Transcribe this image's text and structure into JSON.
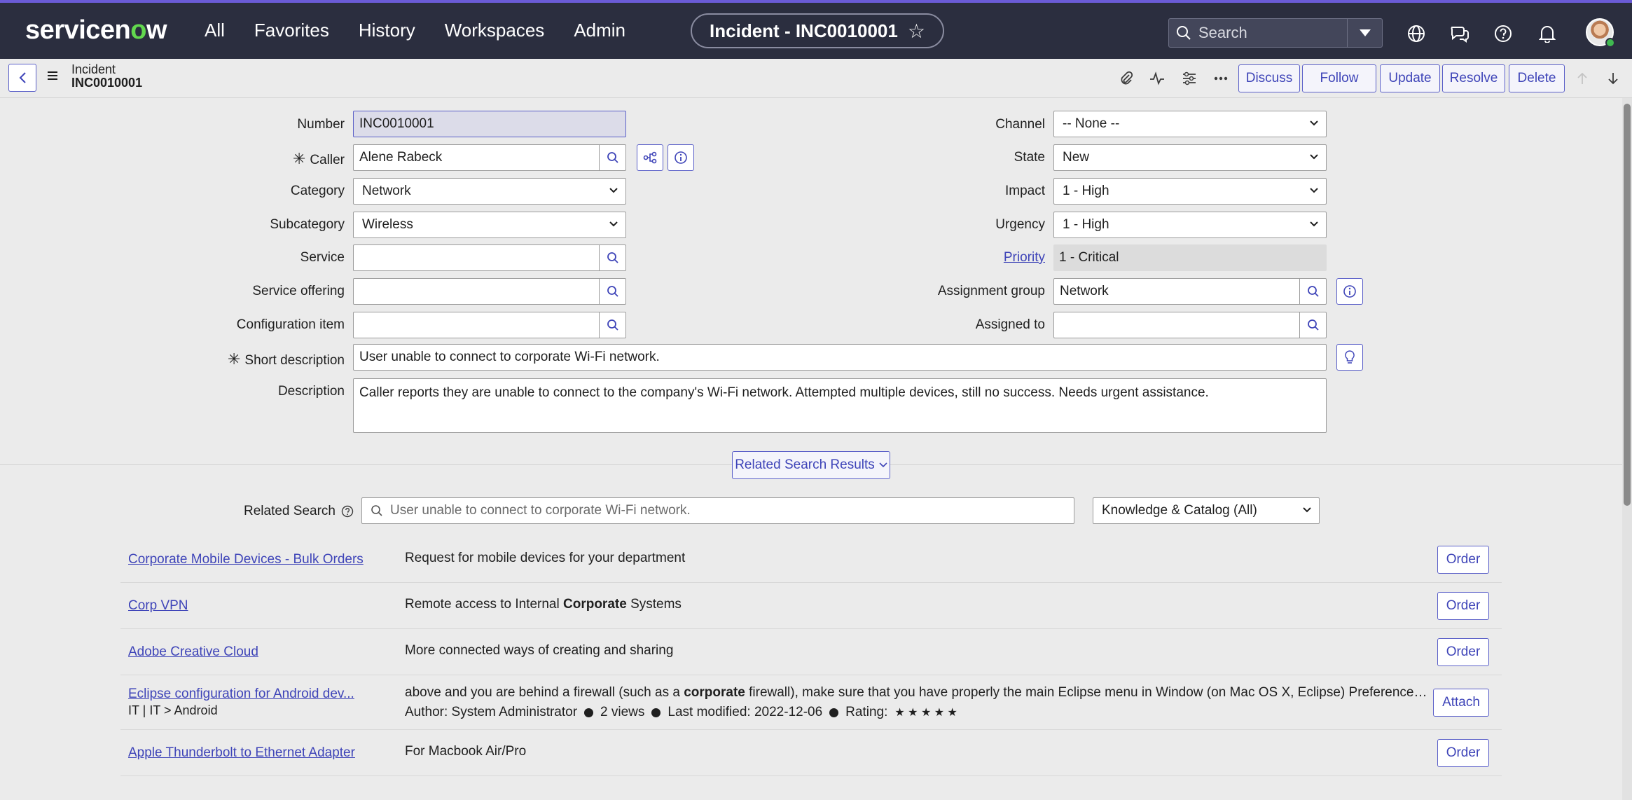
{
  "app": {
    "logo_pre": "servicen",
    "logo_o": "o",
    "logo_post": "w"
  },
  "nav": [
    "All",
    "Favorites",
    "History",
    "Workspaces",
    "Admin"
  ],
  "record_pill": "Incident - INC0010001",
  "search": {
    "placeholder": "Search"
  },
  "header": {
    "table": "Incident",
    "number": "INC0010001",
    "buttons": [
      "Discuss",
      "Follow",
      "Update",
      "Resolve",
      "Delete"
    ]
  },
  "form": {
    "number": {
      "label": "Number",
      "value": "INC0010001"
    },
    "caller": {
      "label": "Caller",
      "value": "Alene Rabeck"
    },
    "category": {
      "label": "Category",
      "value": "Network"
    },
    "subcategory": {
      "label": "Subcategory",
      "value": "Wireless"
    },
    "service": {
      "label": "Service",
      "value": ""
    },
    "service_offering": {
      "label": "Service offering",
      "value": ""
    },
    "configuration_item": {
      "label": "Configuration item",
      "value": ""
    },
    "short_description": {
      "label": "Short description",
      "value": "User unable to connect to corporate Wi-Fi network."
    },
    "description": {
      "label": "Description",
      "value": "Caller reports they are unable to connect to the company's Wi-Fi network. Attempted multiple devices, still no success. Needs urgent assistance."
    },
    "channel": {
      "label": "Channel",
      "value": "-- None --"
    },
    "state": {
      "label": "State",
      "value": "New"
    },
    "impact": {
      "label": "Impact",
      "value": "1 - High"
    },
    "urgency": {
      "label": "Urgency",
      "value": "1 - High"
    },
    "priority": {
      "label": "Priority",
      "value": "1 - Critical"
    },
    "assignment_group": {
      "label": "Assignment group",
      "value": "Network"
    },
    "assigned_to": {
      "label": "Assigned to",
      "value": ""
    }
  },
  "related": {
    "toggle_label": "Related Search Results",
    "label": "Related Search",
    "query": "User unable to connect to corporate Wi-Fi network.",
    "source": "Knowledge & Catalog (All)",
    "results": [
      {
        "title": "Corporate Mobile Devices - Bulk Orders",
        "desc": "Request for mobile devices for your department",
        "action": "Order"
      },
      {
        "title": "Corp VPN",
        "desc_pre": "Remote access to Internal ",
        "desc_bold": "Corporate",
        "desc_post": " Systems",
        "action": "Order"
      },
      {
        "title": "Adobe Creative Cloud",
        "desc": "More connected ways of creating and sharing",
        "action": "Order"
      },
      {
        "title": "Eclipse configuration for Android dev...",
        "sub": "IT | IT > Android",
        "desc_pre": "above and you are behind a firewall (such as a ",
        "desc_bold": "corporate",
        "desc_post": " firewall), make sure that you have properly the main Eclipse menu in Window (on Mac OS X, Eclipse) Preference…",
        "author": "Author: System Administrator",
        "views": "2 views",
        "modified": "Last modified: 2022-12-06",
        "rating_label": "Rating:",
        "rating_stars": "★ ★ ★ ★ ★",
        "action": "Attach"
      },
      {
        "title": "Apple Thunderbolt to Ethernet Adapter",
        "desc": "For Macbook Air/Pro",
        "action": "Order"
      }
    ]
  },
  "colors": {
    "topbar": "#2b2e3f",
    "accent": "#3e44b8",
    "logo_o": "#62d84e"
  }
}
